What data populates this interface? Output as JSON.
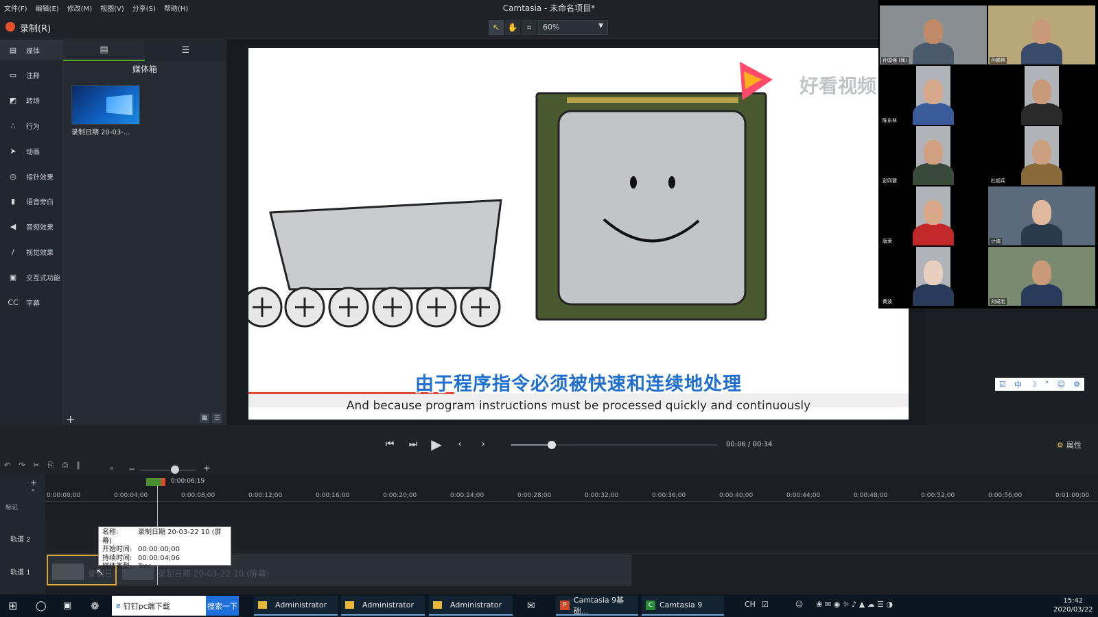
{
  "app": {
    "title": "Camtasia - 未命名项目*",
    "menu": [
      "文件(F)",
      "编辑(E)",
      "修改(M)",
      "视图(V)",
      "分享(S)",
      "帮助(H)"
    ],
    "record_label": "录制(R)",
    "zoom": "60%"
  },
  "tools": [
    {
      "label": "媒体",
      "icon": "film-icon"
    },
    {
      "label": "注释",
      "icon": "callout-icon"
    },
    {
      "label": "转场",
      "icon": "transition-icon"
    },
    {
      "label": "行为",
      "icon": "behavior-icon"
    },
    {
      "label": "动画",
      "icon": "animation-icon"
    },
    {
      "label": "指针效果",
      "icon": "cursor-effect-icon"
    },
    {
      "label": "语音旁白",
      "icon": "microphone-icon"
    },
    {
      "label": "音频效果",
      "icon": "speaker-icon"
    },
    {
      "label": "视觉效果",
      "icon": "wand-icon"
    },
    {
      "label": "交互式功能",
      "icon": "interactive-icon"
    },
    {
      "label": "字幕",
      "icon": "cc-icon"
    }
  ],
  "media_bin": {
    "title": "媒体箱",
    "item_label": "录制日期 20-03-..."
  },
  "canvas": {
    "subtitle_cn": "由于程序指令必须被快速和连续地处理",
    "subtitle_en": "And because program instructions must be processed quickly and continuously",
    "watermark": "好看视频"
  },
  "playback": {
    "current": "00:06",
    "total": "00:34",
    "separator": "/",
    "properties_label": "属性"
  },
  "timeline": {
    "playhead_time": "0:00:06;19",
    "marker_label": "标记",
    "ticks": [
      "0:00:00;00",
      "0:00:04;00",
      "0:00:08;00",
      "0:00:12;00",
      "0:00:16;00",
      "0:00:20;00",
      "0:00:24;00",
      "0:00:28;00",
      "0:00:32;00",
      "0:00:36;00",
      "0:00:40;00",
      "0:00:44;00",
      "0:00:48;00",
      "0:00:52;00",
      "0:00:56;00",
      "0:01:00;00"
    ],
    "tracks": [
      "轨道 2",
      "轨道 1"
    ],
    "clip_label": "录制日期 20-03-22 10 (屏幕)",
    "clip_short": "录制日"
  },
  "tooltip": {
    "rows": [
      {
        "k": "名称:",
        "v": "录制日期 20-03-22 10 (屏幕)"
      },
      {
        "k": "开始时间:",
        "v": "00:00:00;00"
      },
      {
        "k": "持续时间:",
        "v": "00:00:04;06"
      },
      {
        "k": "媒体类型:",
        "v": "Trec"
      }
    ]
  },
  "video_call": {
    "participants": [
      "孙国强 (我)",
      "孙鹏林",
      "陈东林",
      "",
      "彭四健",
      "杜超兵",
      "唐荣",
      "计瑞",
      "黄波",
      "刘成宏"
    ]
  },
  "taskbar": {
    "search_text": "钉钉pc端下载",
    "search_button": "搜索一下",
    "apps": [
      "Administrator",
      "Administrator",
      "Administrator",
      "Camtasia 9基础...",
      "Camtasia 9"
    ],
    "ime": "CH",
    "time": "15:42",
    "date": "2020/03/22"
  }
}
